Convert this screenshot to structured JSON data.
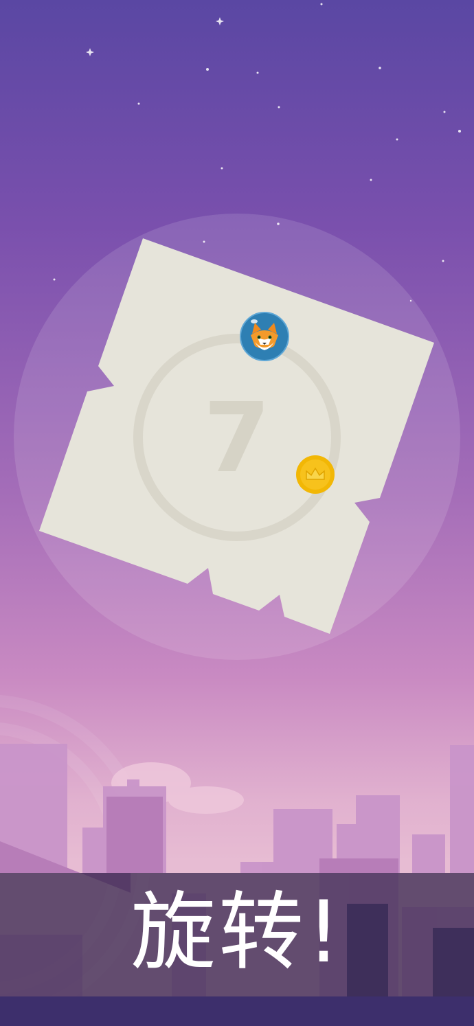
{
  "game": {
    "level_number": "7",
    "player_character": "fox-in-bubble",
    "collectible": "gold-crown-coin"
  },
  "banner": {
    "text": "旋转!"
  },
  "colors": {
    "sky_top": "#5a47a3",
    "sky_mid": "#a46db8",
    "sky_horizon": "#e1b1cf",
    "board": "#e6e4da",
    "ring": "#d7d4c8",
    "player_bubble": "#2e7fb3",
    "coin": "#f2b705",
    "banner_bg": "#302148"
  },
  "icons": [
    "fox-icon",
    "crown-icon",
    "star-icon"
  ]
}
